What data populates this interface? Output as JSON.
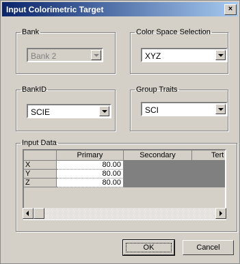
{
  "window": {
    "title": "Input Colorimetric Target",
    "close_label": "×"
  },
  "bank": {
    "legend": "Bank",
    "value": "Bank 2"
  },
  "color_space": {
    "legend": "Color Space Selection",
    "value": "XYZ"
  },
  "bank_id": {
    "legend": "BankID",
    "value": "SCIE"
  },
  "group_traits": {
    "legend": "Group Traits",
    "value": "SCI"
  },
  "input_data": {
    "legend": "Input Data",
    "columns": [
      "Primary",
      "Secondary",
      "Tert"
    ],
    "rows": [
      {
        "label": "X",
        "primary": "80.00"
      },
      {
        "label": "Y",
        "primary": "80.00"
      },
      {
        "label": "Z",
        "primary": "80.00"
      }
    ]
  },
  "buttons": {
    "ok": "OK",
    "cancel": "Cancel"
  }
}
